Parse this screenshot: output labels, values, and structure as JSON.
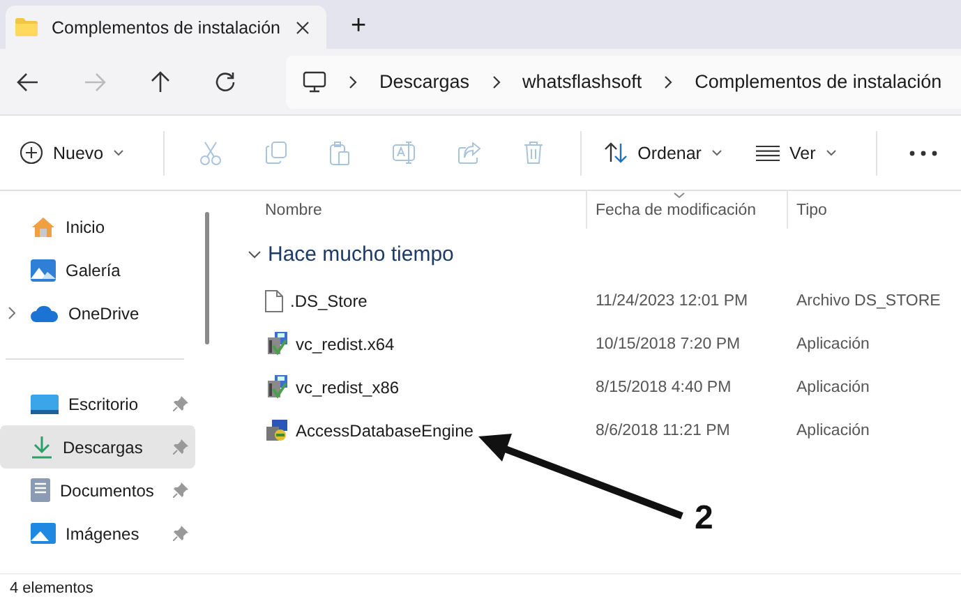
{
  "tabs": [
    {
      "title": "Complementos de instalación",
      "selected": true
    }
  ],
  "new_tab": "+",
  "breadcrumb": [
    "Descargas",
    "whatsflashsoft",
    "Complementos de instalación"
  ],
  "toolbar": [
    {
      "kind": "new",
      "label": "Nuevo"
    },
    {
      "kind": "cut",
      "disabled": true
    },
    {
      "kind": "copy",
      "disabled": true
    },
    {
      "kind": "paste",
      "disabled": true
    },
    {
      "kind": "rename",
      "disabled": true
    },
    {
      "kind": "share",
      "disabled": true
    },
    {
      "kind": "delete",
      "disabled": true
    },
    {
      "kind": "sort",
      "label": "Ordenar"
    },
    {
      "kind": "view",
      "label": "Ver"
    },
    {
      "kind": "more",
      "disabled": false
    }
  ],
  "sidebar": {
    "sections": [
      [
        {
          "label": "Inicio",
          "kind": "home",
          "expandable": false,
          "pinned": false,
          "selected": false
        },
        {
          "label": "Galería",
          "kind": "gallery",
          "expandable": false,
          "pinned": false,
          "selected": false
        },
        {
          "label": "OneDrive",
          "kind": "cloud",
          "expandable": true,
          "pinned": false,
          "selected": false
        }
      ],
      [
        {
          "label": "Escritorio",
          "kind": "desktop",
          "expandable": false,
          "pinned": true,
          "selected": false
        },
        {
          "label": "Descargas",
          "kind": "download",
          "expandable": false,
          "pinned": true,
          "selected": true
        },
        {
          "label": "Documentos",
          "kind": "document",
          "expandable": false,
          "pinned": true,
          "selected": false
        },
        {
          "label": "Imágenes",
          "kind": "image",
          "expandable": false,
          "pinned": true,
          "selected": false
        }
      ]
    ]
  },
  "table": {
    "columns": [
      "Nombre",
      "Fecha de modificación",
      "Tipo"
    ],
    "group": {
      "label": "Hace mucho tiempo",
      "expanded": true
    },
    "rows": [
      {
        "kind": "file",
        "name": ".DS_Store",
        "date": "11/24/2023 12:01 PM",
        "type": "Archivo DS_STORE"
      },
      {
        "kind": "installer",
        "name": "vc_redist.x64",
        "date": "10/15/2018 7:20 PM",
        "type": "Aplicación"
      },
      {
        "kind": "installer",
        "name": "vc_redist_x86",
        "date": "8/15/2018 4:40 PM",
        "type": "Aplicación"
      },
      {
        "kind": "setup",
        "name": "AccessDatabaseEngine",
        "date": "8/6/2018 11:21 PM",
        "type": "Aplicación"
      }
    ]
  },
  "annotation": {
    "label": "2"
  },
  "status_bar": "4 elementos"
}
